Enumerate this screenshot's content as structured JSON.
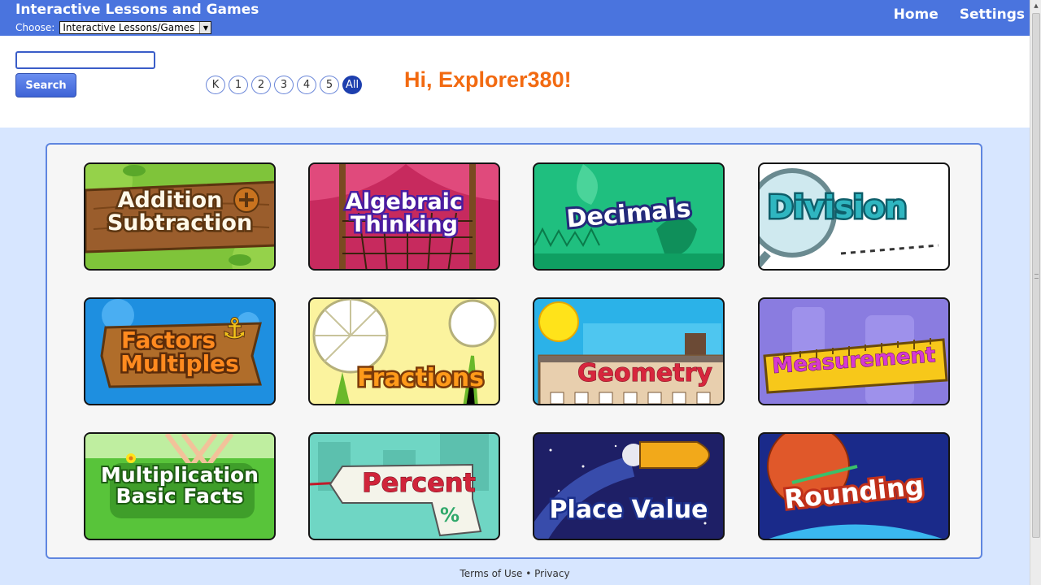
{
  "header": {
    "title": "Interactive Lessons and Games",
    "choose_label": "Choose:",
    "choose_value": "Interactive Lessons/Games",
    "nav": {
      "home": "Home",
      "settings": "Settings"
    },
    "color": "#4a74de"
  },
  "search": {
    "placeholder": "",
    "value": "",
    "button_label": "Search"
  },
  "grades": [
    "K",
    "1",
    "2",
    "3",
    "4",
    "5",
    "All"
  ],
  "selected_grade": "All",
  "greeting": "Hi, Explorer380!",
  "topics": [
    {
      "line1": "Addition",
      "line2": "Subtraction",
      "icon": "acorn-plus-icon"
    },
    {
      "line1": "Algebraic",
      "line2": "Thinking",
      "icon": "net-icon"
    },
    {
      "line1": "Decimals",
      "line2": "",
      "icon": "butterfly-icon"
    },
    {
      "line1": "Division",
      "line2": "",
      "icon": "magnifier-icon"
    },
    {
      "line1": "Factors",
      "line2": "Multiples",
      "icon": "anchor-icon"
    },
    {
      "line1": "Fractions",
      "line2": "",
      "icon": "citrus-slice-icon"
    },
    {
      "line1": "Geometry",
      "line2": "",
      "icon": "building-icon"
    },
    {
      "line1": "Measurement",
      "line2": "",
      "icon": "ruler-icon"
    },
    {
      "line1": "Multiplication",
      "line2": "Basic Facts",
      "icon": "flower-icon"
    },
    {
      "line1": "Percent",
      "line2": "",
      "icon": "price-tag-icon"
    },
    {
      "line1": "Place Value",
      "line2": "",
      "icon": "rocket-icon"
    },
    {
      "line1": "Rounding",
      "line2": "",
      "icon": "planet-icon"
    }
  ],
  "footer": {
    "terms": "Terms of Use",
    "separator": "•",
    "privacy": "Privacy"
  }
}
